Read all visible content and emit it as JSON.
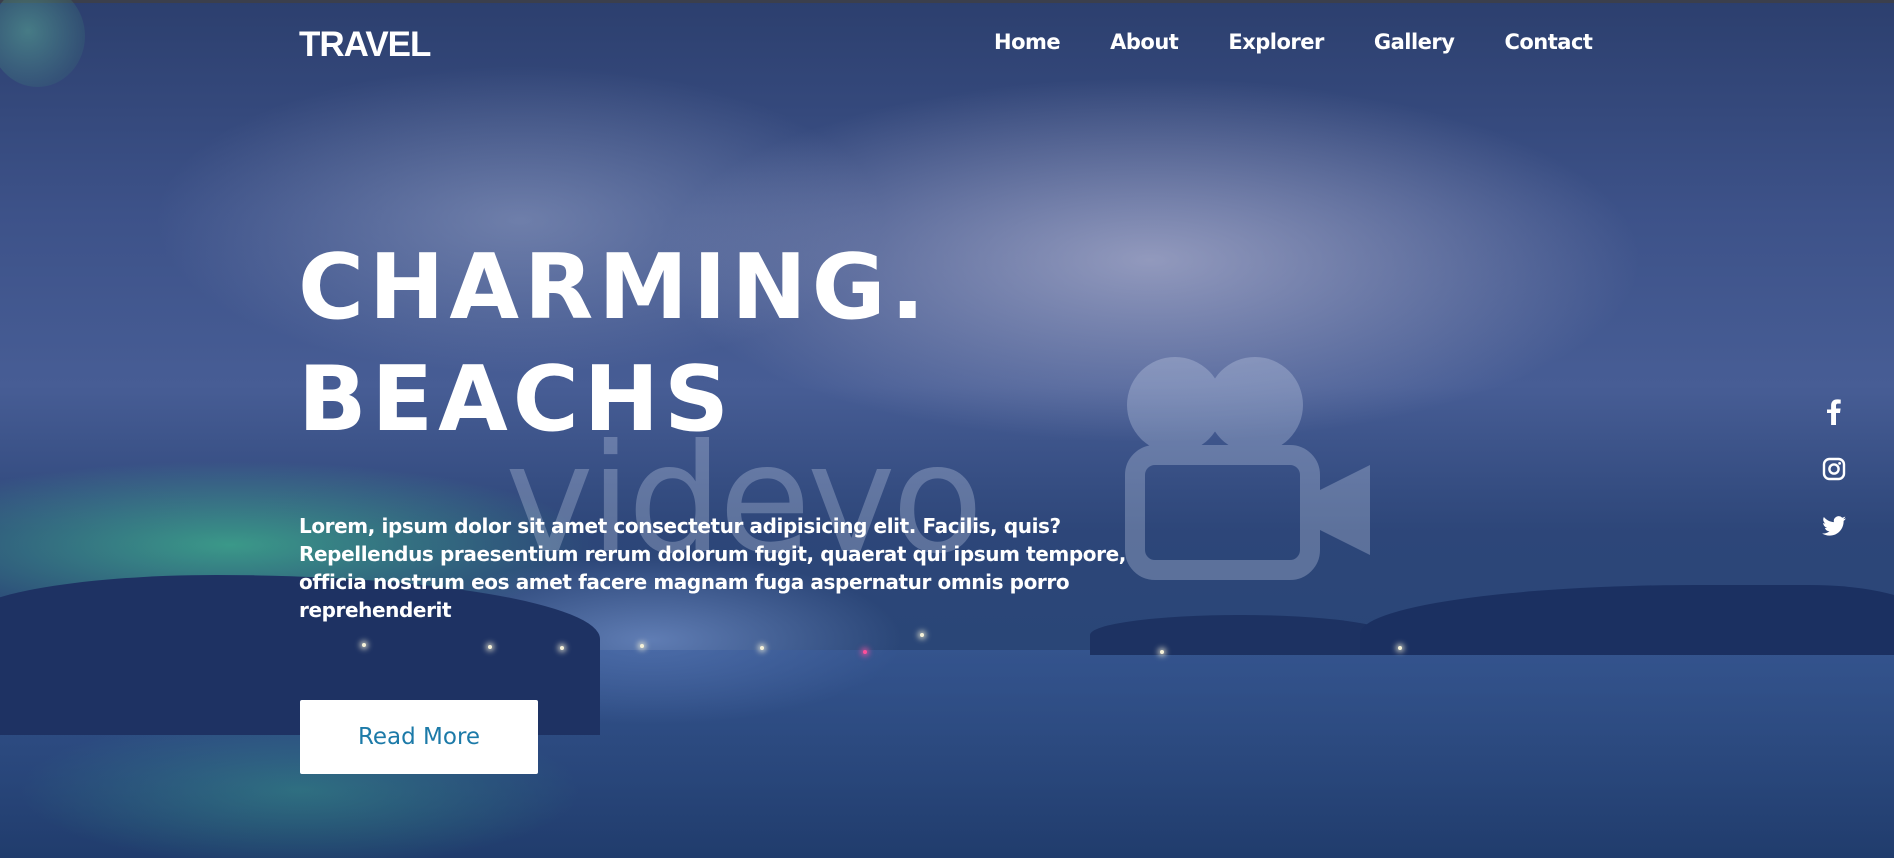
{
  "nav": {
    "logo": "TRAVEL",
    "items": [
      {
        "label": "Home"
      },
      {
        "label": "About"
      },
      {
        "label": "Explorer"
      },
      {
        "label": "Gallery"
      },
      {
        "label": "Contact"
      }
    ]
  },
  "hero": {
    "headline_line1": "CHARMING.",
    "headline_line2": "BEACHS",
    "description": "Lorem, ipsum dolor sit amet consectetur adipisicing elit. Facilis, quis? Repellendus praesentium rerum dolorum fugit, quaerat qui ipsum tempore, officia nostrum eos amet facere magnam fuga aspernatur omnis porro reprehenderit",
    "button_label": "Read More",
    "watermark": "videvo"
  },
  "social": [
    {
      "icon": "facebook-icon"
    },
    {
      "icon": "instagram-icon"
    },
    {
      "icon": "twitter-icon"
    }
  ],
  "colors": {
    "accent": "#1c7aa8",
    "text": "#ffffff",
    "sky_dark": "#203c6c"
  }
}
